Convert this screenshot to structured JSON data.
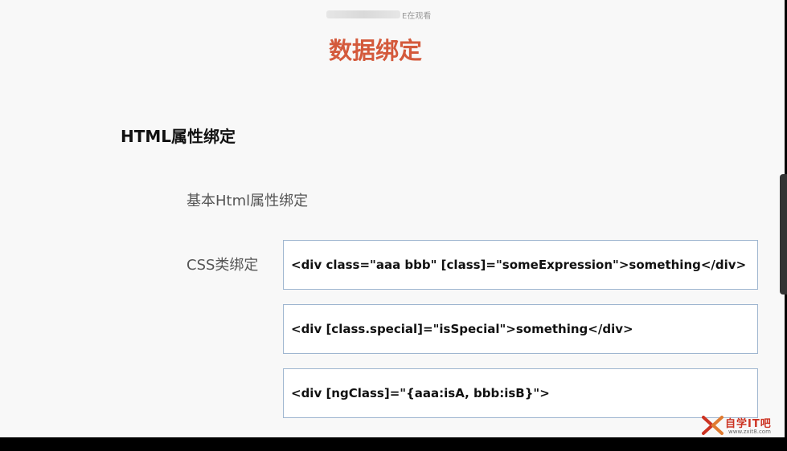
{
  "viewer_notice": {
    "text": "E在观看"
  },
  "slide": {
    "title": "数据绑定",
    "section_heading": "HTML属性绑定",
    "items": {
      "basic": "基本Html属性绑定",
      "css": "CSS类绑定"
    },
    "code_examples": [
      "<div class=\"aaa bbb\" [class]=\"someExpression\">something</div>",
      "<div [class.special]=\"isSpecial\">something</div>",
      "<div [ngClass]=\"{aaa:isA, bbb:isB}\">"
    ]
  },
  "watermark": {
    "name": "自学IT吧",
    "url": "www.zxit8.com"
  },
  "colors": {
    "title": "#d45a3c",
    "box_border": "#9fb6d0",
    "watermark": "#cc3322"
  }
}
